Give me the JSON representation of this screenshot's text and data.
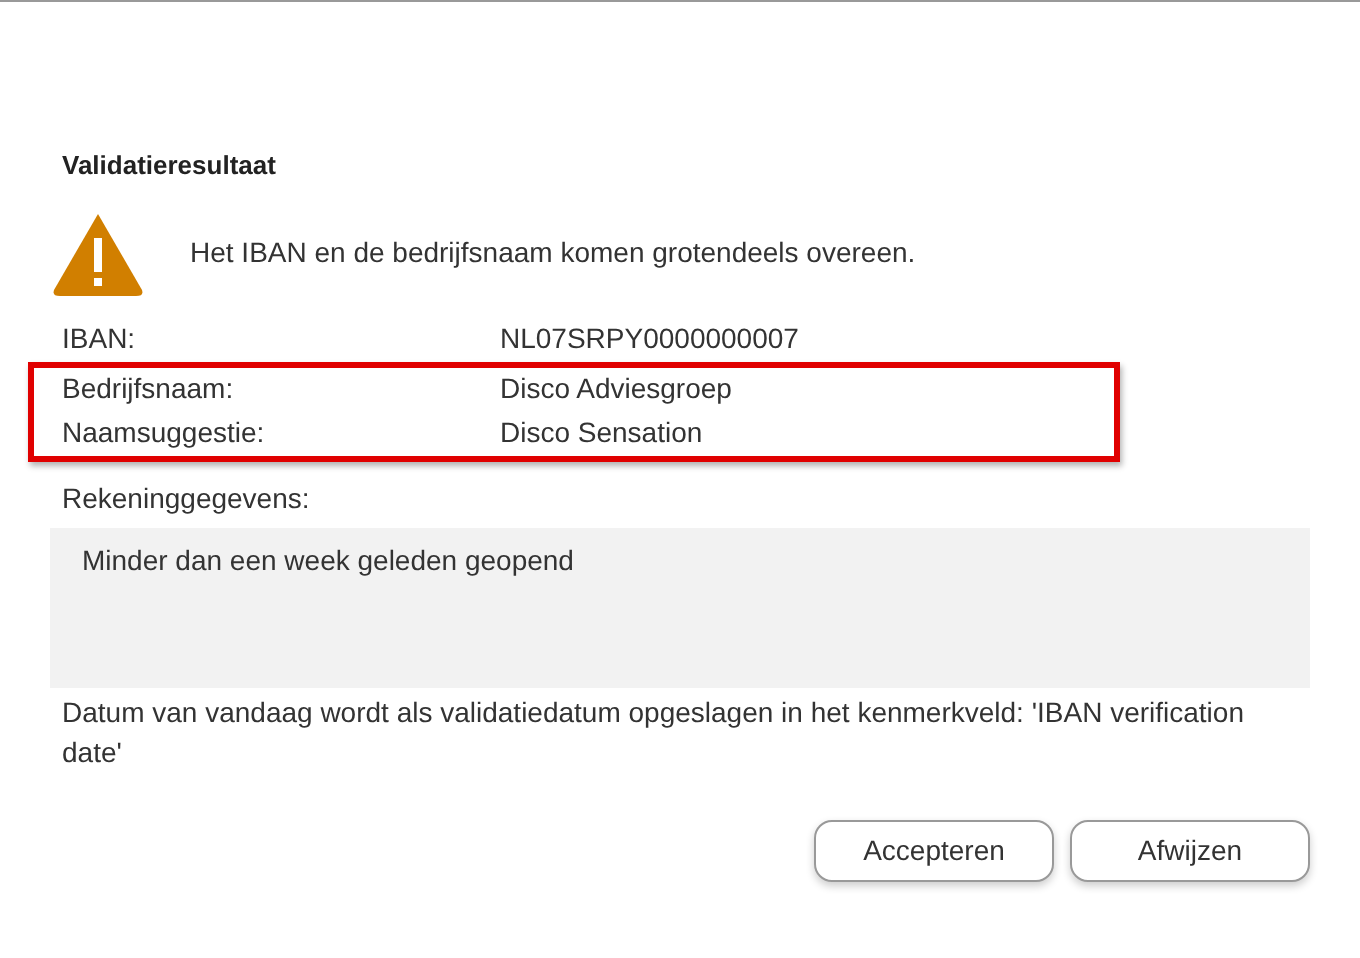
{
  "dialog": {
    "title": "Validatieresultaat"
  },
  "message": {
    "kind": "warning",
    "text": "Het IBAN en de bedrijfsnaam komen grotendeels overeen."
  },
  "details": [
    {
      "label": "IBAN:",
      "value": "NL07SRPY0000000007",
      "highlighted": false
    },
    {
      "label": "Bedrijfsnaam:",
      "value": "Disco Adviesgroep",
      "highlighted": true
    },
    {
      "label": "Naamsuggestie:",
      "value": "Disco Sensation",
      "highlighted": true
    }
  ],
  "account_info": {
    "label": "Rekeninggegevens:",
    "value": "Minder dan een week geleden geopend"
  },
  "note": "Datum van vandaag wordt als validatiedatum opgeslagen in het kenmerkveld: 'IBAN verification date'",
  "buttons": [
    "Accepteren",
    "Afwijzen"
  ]
}
